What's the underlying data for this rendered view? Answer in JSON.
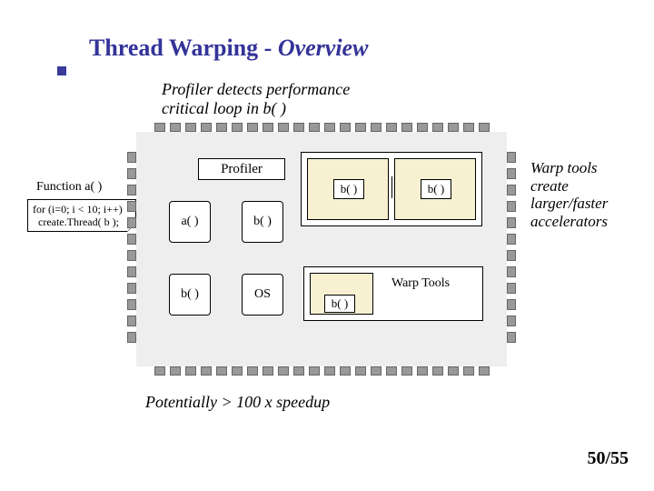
{
  "title_a": "Thread Warping - ",
  "title_b": "Overview",
  "profiler_note_l1": "Profiler detects performance",
  "profiler_note_l2": "critical loop in b( )",
  "warp_note_l1": "Warp tools",
  "warp_note_l2": "create",
  "warp_note_l3": "larger/faster",
  "warp_note_l4": "accelerators",
  "speedup": "Potentially > 100 x speedup",
  "pagenum": "50/55",
  "func_label": "Function a( )",
  "code_l1": "for (i=0; i < 10; i++)",
  "code_l2": "  create.Thread( b );",
  "profiler_box": "Profiler",
  "a_lbl": "a( )",
  "b_lbl": "b( )",
  "os_lbl": "OS",
  "warp_tools": "Warp Tools"
}
